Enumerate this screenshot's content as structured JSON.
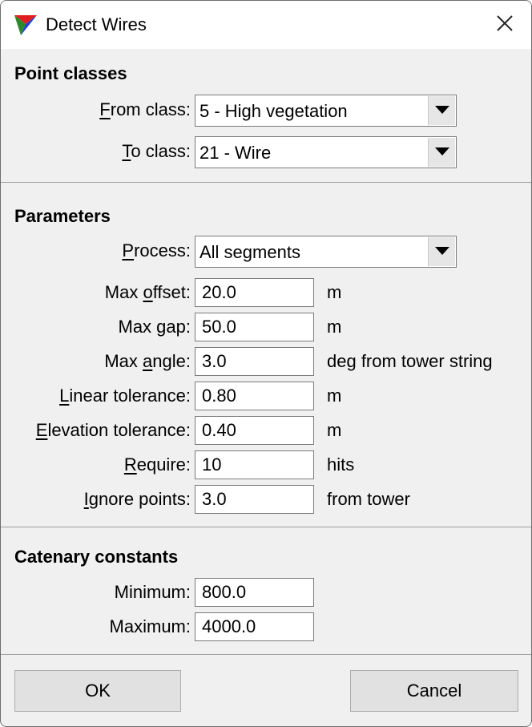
{
  "window": {
    "title": "Detect Wires",
    "icon": "tri-color-triangle-icon",
    "close_icon": "close-icon"
  },
  "point_classes": {
    "title": "Point classes",
    "from_class": {
      "label_mnemonic": "F",
      "label_rest": "rom class:",
      "value": "5 - High vegetation"
    },
    "to_class": {
      "label_mnemonic": "T",
      "label_rest": "o class:",
      "value": "21 - Wire"
    }
  },
  "parameters": {
    "title": "Parameters",
    "process": {
      "label_pre": "",
      "label_mnemonic": "P",
      "label_rest": "rocess:",
      "value": "All segments"
    },
    "max_offset": {
      "label_pre": "Max ",
      "label_mnemonic": "o",
      "label_rest": "ffset:",
      "value": "20.0",
      "unit": "m"
    },
    "max_gap": {
      "label_pre": "Max gap:",
      "label_mnemonic": "",
      "label_rest": "",
      "value": "50.0",
      "unit": "m"
    },
    "max_angle": {
      "label_pre": "Max ",
      "label_mnemonic": "a",
      "label_rest": "ngle:",
      "value": "3.0",
      "unit": "deg from tower string"
    },
    "linear_tolerance": {
      "label_pre": "",
      "label_mnemonic": "L",
      "label_rest": "inear tolerance:",
      "value": "0.80",
      "unit": "m"
    },
    "elevation_tolerance": {
      "label_pre": "",
      "label_mnemonic": "E",
      "label_rest": "levation tolerance:",
      "value": "0.40",
      "unit": "m"
    },
    "require": {
      "label_pre": "",
      "label_mnemonic": "R",
      "label_rest": "equire:",
      "value": "10",
      "unit": "hits"
    },
    "ignore_points": {
      "label_pre": "",
      "label_mnemonic": "I",
      "label_rest": "gnore points:",
      "value": "3.0",
      "unit": "from tower"
    }
  },
  "catenary": {
    "title": "Catenary constants",
    "minimum": {
      "label": "Minimum:",
      "value": "800.0"
    },
    "maximum": {
      "label": "Maximum:",
      "value": "4000.0"
    }
  },
  "buttons": {
    "ok": "OK",
    "cancel": "Cancel"
  },
  "colors": {
    "dialog_bg": "#f0f0f0",
    "titlebar_bg": "#ffffff",
    "button_bg": "#e1e1e1"
  }
}
